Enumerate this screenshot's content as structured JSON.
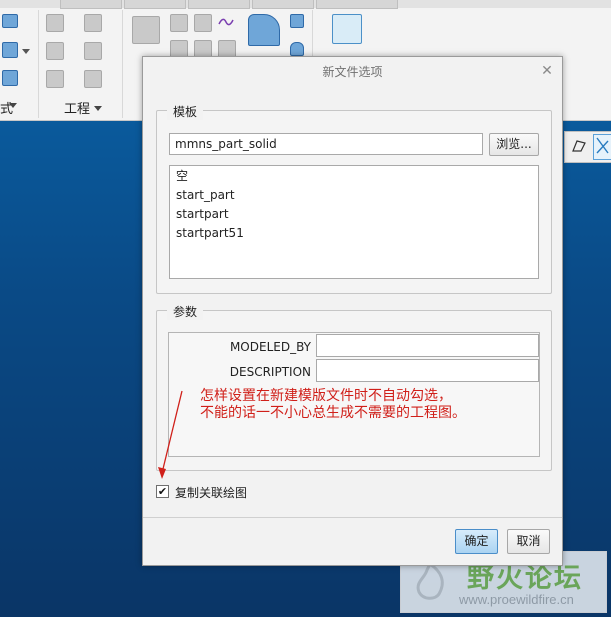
{
  "ribbon": {
    "group_label_left": "式",
    "group_label_engineering": "工程"
  },
  "dialog": {
    "title": "新文件选项",
    "template_section": {
      "legend": "模板",
      "template_value": "mmns_part_solid",
      "browse_label": "浏览...",
      "items": [
        "空",
        "start_part",
        "startpart",
        "startpart51"
      ]
    },
    "params_section": {
      "legend": "参数",
      "rows": [
        {
          "label": "MODELED_BY",
          "value": ""
        },
        {
          "label": "DESCRIPTION",
          "value": ""
        }
      ]
    },
    "annotation": {
      "line1": "怎样设置在新建模版文件时不自动勾选，",
      "line2": "不能的话一不小心总生成不需要的工程图。",
      "color": "#d0201a"
    },
    "copy_drawing": {
      "label": "复制关联绘图",
      "checked": true,
      "mark": "✔"
    },
    "ok_label": "确定",
    "cancel_label": "取消"
  },
  "watermark": {
    "title": "野火论坛",
    "url": "www.proewildfire.cn"
  }
}
